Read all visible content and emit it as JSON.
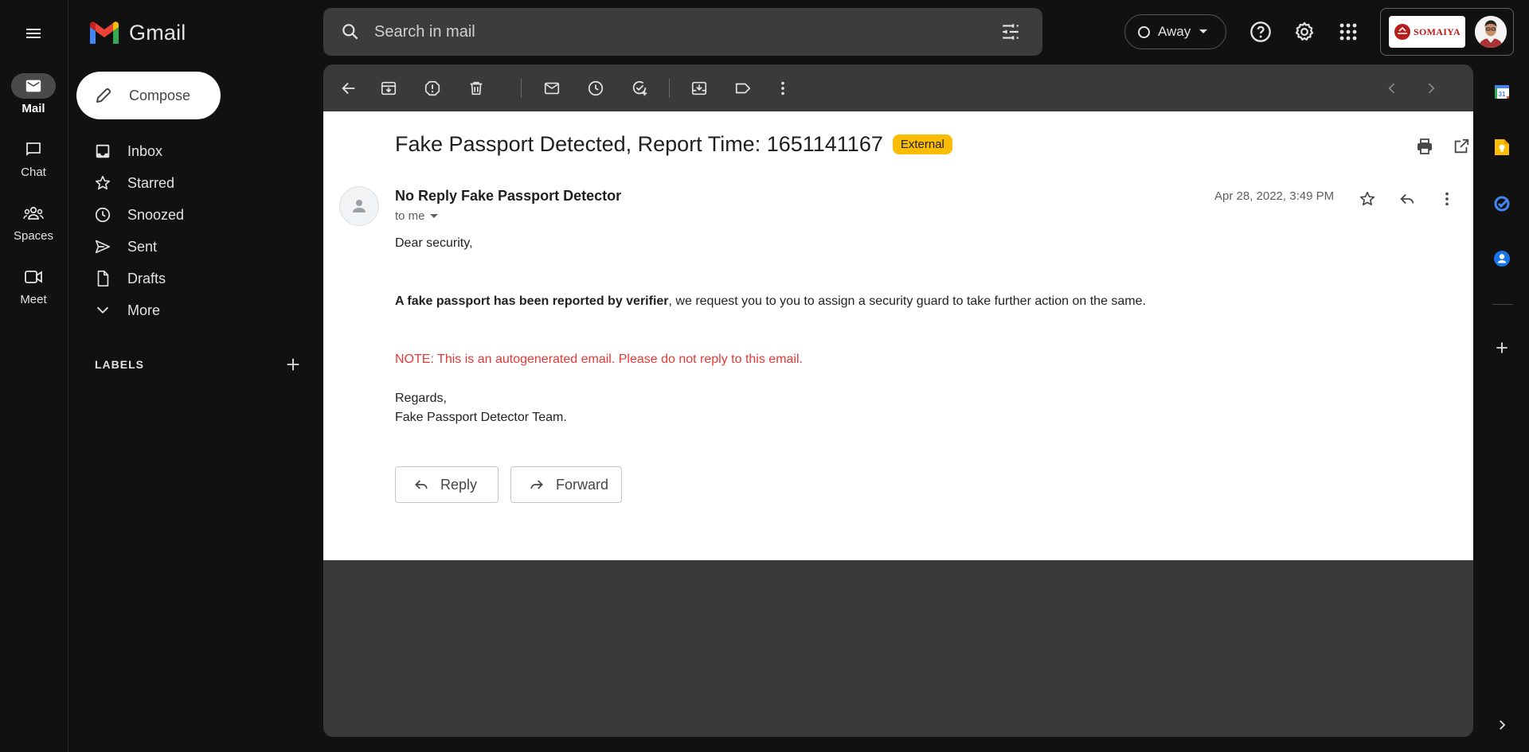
{
  "app": {
    "name": "Gmail"
  },
  "rail": {
    "items": [
      {
        "label": "Mail",
        "icon": "mail-icon",
        "active": true
      },
      {
        "label": "Chat",
        "icon": "chat-icon"
      },
      {
        "label": "Spaces",
        "icon": "spaces-icon"
      },
      {
        "label": "Meet",
        "icon": "meet-icon"
      }
    ]
  },
  "search": {
    "placeholder": "Search in mail"
  },
  "status": {
    "label": "Away"
  },
  "account": {
    "org_name": "SOMAIYA"
  },
  "compose": {
    "label": "Compose"
  },
  "nav": {
    "items": [
      {
        "label": "Inbox",
        "icon": "inbox-icon"
      },
      {
        "label": "Starred",
        "icon": "star-icon"
      },
      {
        "label": "Snoozed",
        "icon": "clock-icon"
      },
      {
        "label": "Sent",
        "icon": "send-icon"
      },
      {
        "label": "Drafts",
        "icon": "draft-icon"
      },
      {
        "label": "More",
        "icon": "chevron-down-icon"
      }
    ],
    "labels_heading": "LABELS"
  },
  "email": {
    "subject": "Fake Passport Detected, Report Time: 1651141167",
    "badge": "External",
    "sender": "No Reply Fake Passport Detector",
    "to": "to me",
    "date": "Apr 28, 2022, 3:49 PM",
    "greeting": "Dear security,",
    "bold_text": "A fake passport has been reported by verifier",
    "body_rest": ", we request you to you to assign a security guard to take further action on the same.",
    "note": "NOTE: This is an autogenerated email. Please do not reply to this email.",
    "regards": "Regards,",
    "team": "Fake Passport Detector Team."
  },
  "actions": {
    "reply": "Reply",
    "forward": "Forward"
  },
  "colors": {
    "background": "#111111",
    "card": "#3a3a3a",
    "badge": "#fbbc04",
    "note": "#e53935"
  }
}
